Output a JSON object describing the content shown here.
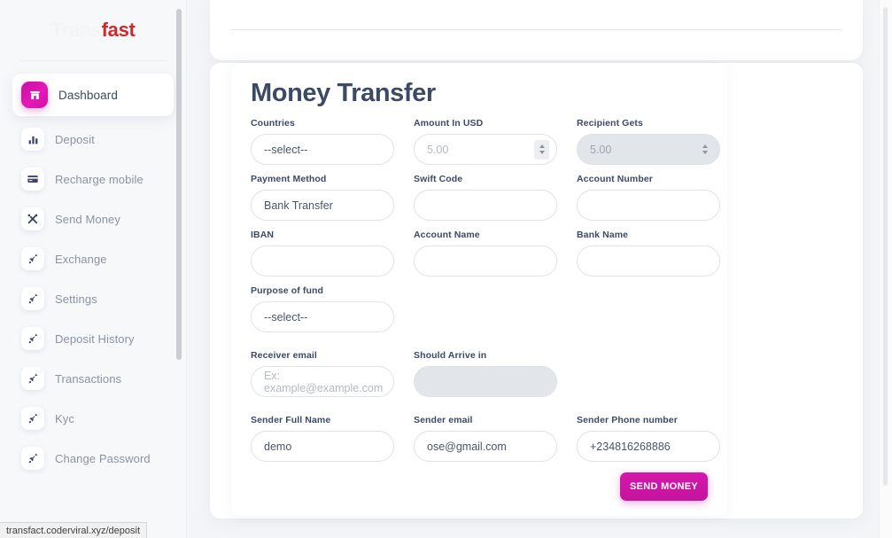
{
  "brand": {
    "part1": "Trans",
    "part2": "fast"
  },
  "sidebar": {
    "items": [
      {
        "label": "Dashboard",
        "icon": "home-icon",
        "active": true
      },
      {
        "label": "Deposit",
        "icon": "bar-chart-icon",
        "active": false
      },
      {
        "label": "Recharge mobile",
        "icon": "credit-card-icon",
        "active": false
      },
      {
        "label": "Send Money",
        "icon": "tools-icon",
        "active": false
      },
      {
        "label": "Exchange",
        "icon": "rocket-icon",
        "active": false
      },
      {
        "label": "Settings",
        "icon": "rocket-icon",
        "active": false
      },
      {
        "label": "Deposit History",
        "icon": "rocket-icon",
        "active": false
      },
      {
        "label": "Transactions",
        "icon": "rocket-icon",
        "active": false
      },
      {
        "label": "Kyc",
        "icon": "rocket-icon",
        "active": false
      },
      {
        "label": "Change Password",
        "icon": "rocket-icon",
        "active": false
      }
    ]
  },
  "main": {
    "title": "Money Transfer",
    "fields": {
      "countries": {
        "label": "Countries",
        "value": "--select--"
      },
      "amount_usd": {
        "label": "Amount In USD",
        "placeholder": "5.00"
      },
      "recipient": {
        "label": "Recipient Gets",
        "placeholder": "5.00"
      },
      "payment": {
        "label": "Payment Method",
        "value": "Bank Transfer"
      },
      "swift": {
        "label": "Swift Code",
        "value": ""
      },
      "account_no": {
        "label": "Account Number",
        "value": ""
      },
      "iban": {
        "label": "IBAN",
        "value": ""
      },
      "account_name": {
        "label": "Account Name",
        "value": ""
      },
      "bank_name": {
        "label": "Bank Name",
        "value": ""
      },
      "purpose": {
        "label": "Purpose of fund",
        "value": "--select--"
      },
      "recv_email": {
        "label": "Receiver email",
        "placeholder": "Ex: example@example.com"
      },
      "arrive": {
        "label": "Should Arrive in",
        "value": ""
      },
      "sender_name": {
        "label": "Sender Full Name",
        "value": "demo"
      },
      "sender_email": {
        "label": "Sender email",
        "value": "ose@gmail.com"
      },
      "sender_phone": {
        "label": "Sender Phone number",
        "value": "+234816268886"
      }
    },
    "send_button": "SEND MONEY"
  },
  "statusbar": {
    "url": "transfact.coderviral.xyz/deposit"
  },
  "colors": {
    "accent": "#d616ad",
    "brand_red": "#d1282b",
    "label": "#3d4a63",
    "sidebar_bg": "#f7f8fa",
    "page_bg": "#f4f5f7"
  }
}
